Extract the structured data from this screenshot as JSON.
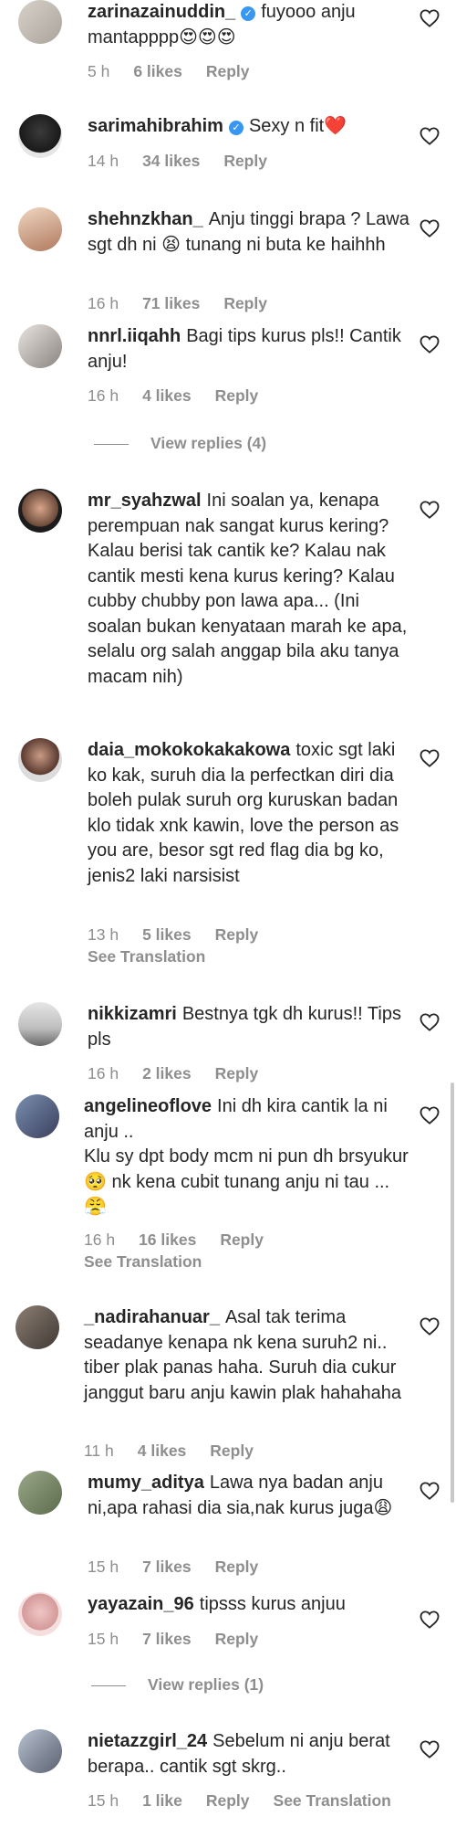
{
  "labels": {
    "reply": "Reply",
    "see_translation": "See Translation"
  },
  "icons": {
    "like": "heart-outline-icon",
    "verified": "verified-badge-icon"
  },
  "colors": {
    "text": "#262626",
    "muted": "#8e8e8e",
    "verified": "#3897f0",
    "background": "#ffffff"
  },
  "comments": [
    {
      "username": "zarinazainuddin_",
      "verified": true,
      "text": "fuyooo anju mantapppp😍😍😍",
      "time": "5 h",
      "likes": "6 likes",
      "reply": "Reply"
    },
    {
      "username": "sarimahibrahim",
      "verified": true,
      "text": "Sexy n fit❤️",
      "time": "14 h",
      "likes": "34 likes",
      "reply": "Reply"
    },
    {
      "username": "shehnzkhan_",
      "verified": false,
      "text": "Anju tinggi brapa ? Lawa sgt dh ni 😫 tunang ni buta ke haihhh",
      "time": "16 h",
      "likes": "71 likes",
      "reply": "Reply"
    },
    {
      "username": "nnrl.iiqahh",
      "verified": false,
      "text": "Bagi tips kurus pls!! Cantik anju!",
      "time": "16 h",
      "likes": "4 likes",
      "reply": "Reply"
    },
    {
      "username": "mr_syahzwal",
      "verified": false,
      "text": "Ini soalan ya, kenapa perempuan nak sangat kurus kering? Kalau berisi tak cantik ke? Kalau nak cantik mesti kena kurus kering? Kalau cubby chubby pon lawa apa... (Ini soalan bukan kenyataan marah ke apa, selalu org salah anggap bila aku tanya macam nih)"
    },
    {
      "username": "daia_mokokokakakowa",
      "verified": false,
      "text": "toxic sgt laki ko kak, suruh dia la perfectkan diri dia boleh pulak suruh org kuruskan badan klo tidak xnk kawin, love the person as you are, besor sgt red flag dia bg ko, jenis2 laki narsisist",
      "time": "13 h",
      "likes": "5 likes",
      "reply": "Reply",
      "see_translation": true
    },
    {
      "username": "nikkizamri",
      "verified": false,
      "text": "Bestnya tgk dh kurus!! Tips pls",
      "time": "16 h",
      "likes": "2 likes",
      "reply": "Reply"
    },
    {
      "username": "angelineoflove",
      "verified": false,
      "text": "Ini dh kira cantik la ni anju ..\nKlu sy dpt body mcm ni pun dh brsyukur 🥺 nk kena cubit tunang anju ni tau ...😤",
      "time": "16 h",
      "likes": "16 likes",
      "reply": "Reply",
      "see_translation": true
    },
    {
      "username": "_nadirahanuar_",
      "verified": false,
      "text": "Asal tak terima seadanye kenapa nk kena suruh2 ni.. tiber plak panas haha. Suruh dia cukur janggut baru anju kawin plak hahahaha",
      "time": "11 h",
      "likes": "4 likes",
      "reply": "Reply"
    },
    {
      "username": "mumy_aditya",
      "verified": false,
      "text": "Lawa nya badan anju ni,apa rahasi dia sia,nak kurus juga😩",
      "time": "15 h",
      "likes": "7 likes",
      "reply": "Reply"
    },
    {
      "username": "yayazain_96",
      "verified": false,
      "text": "tipsss kurus anjuu",
      "time": "15 h",
      "likes": "7 likes",
      "reply": "Reply"
    },
    {
      "username": "nietazzgirl_24",
      "verified": false,
      "text": "Sebelum ni anju berat berapa.. cantik sgt skrg..",
      "time": "15 h",
      "likes": "1 like",
      "reply": "Reply",
      "see_translation_inline": "See Translation"
    }
  ],
  "view_replies": [
    {
      "label": "View replies (4)"
    },
    {
      "label": "View replies (1)"
    }
  ]
}
